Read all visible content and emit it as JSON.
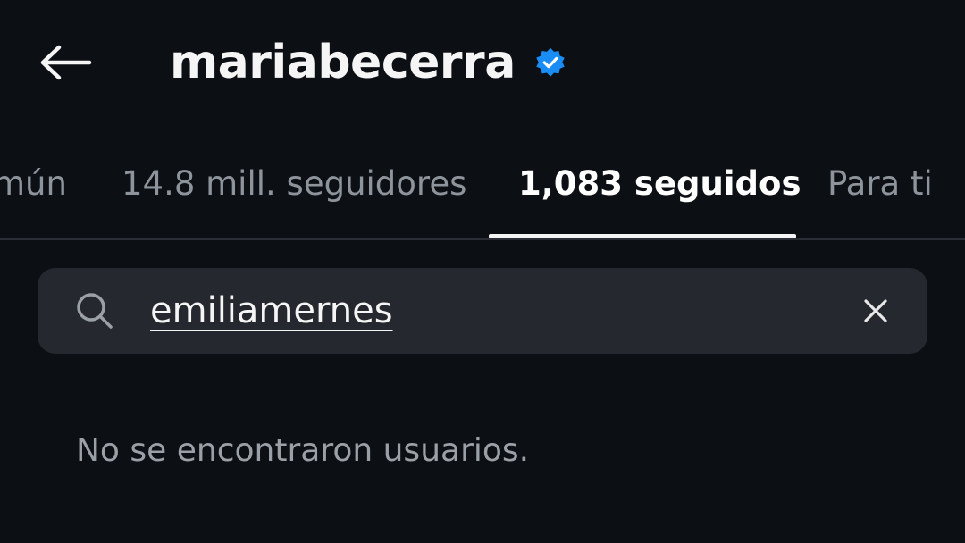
{
  "header": {
    "title": "mariabecerra",
    "back_icon": "arrow-left-icon",
    "verified_icon": "verified-badge-icon",
    "verified_color": "#1a8cf5"
  },
  "tabs": [
    {
      "label": "mún",
      "active": false
    },
    {
      "label": "14.8 mill. seguidores",
      "active": false
    },
    {
      "label": "1,083 seguidos",
      "active": true
    },
    {
      "label": "Para ti",
      "active": false
    }
  ],
  "search": {
    "value": "emiliamernes",
    "search_icon": "search-icon",
    "clear_icon": "close-icon"
  },
  "results": {
    "empty_message": "No se encontraron usuarios."
  },
  "colors": {
    "background": "#0c0f14",
    "search_background": "#25282e",
    "inactive_tab": "#8e949c",
    "active_tab": "#ffffff"
  }
}
